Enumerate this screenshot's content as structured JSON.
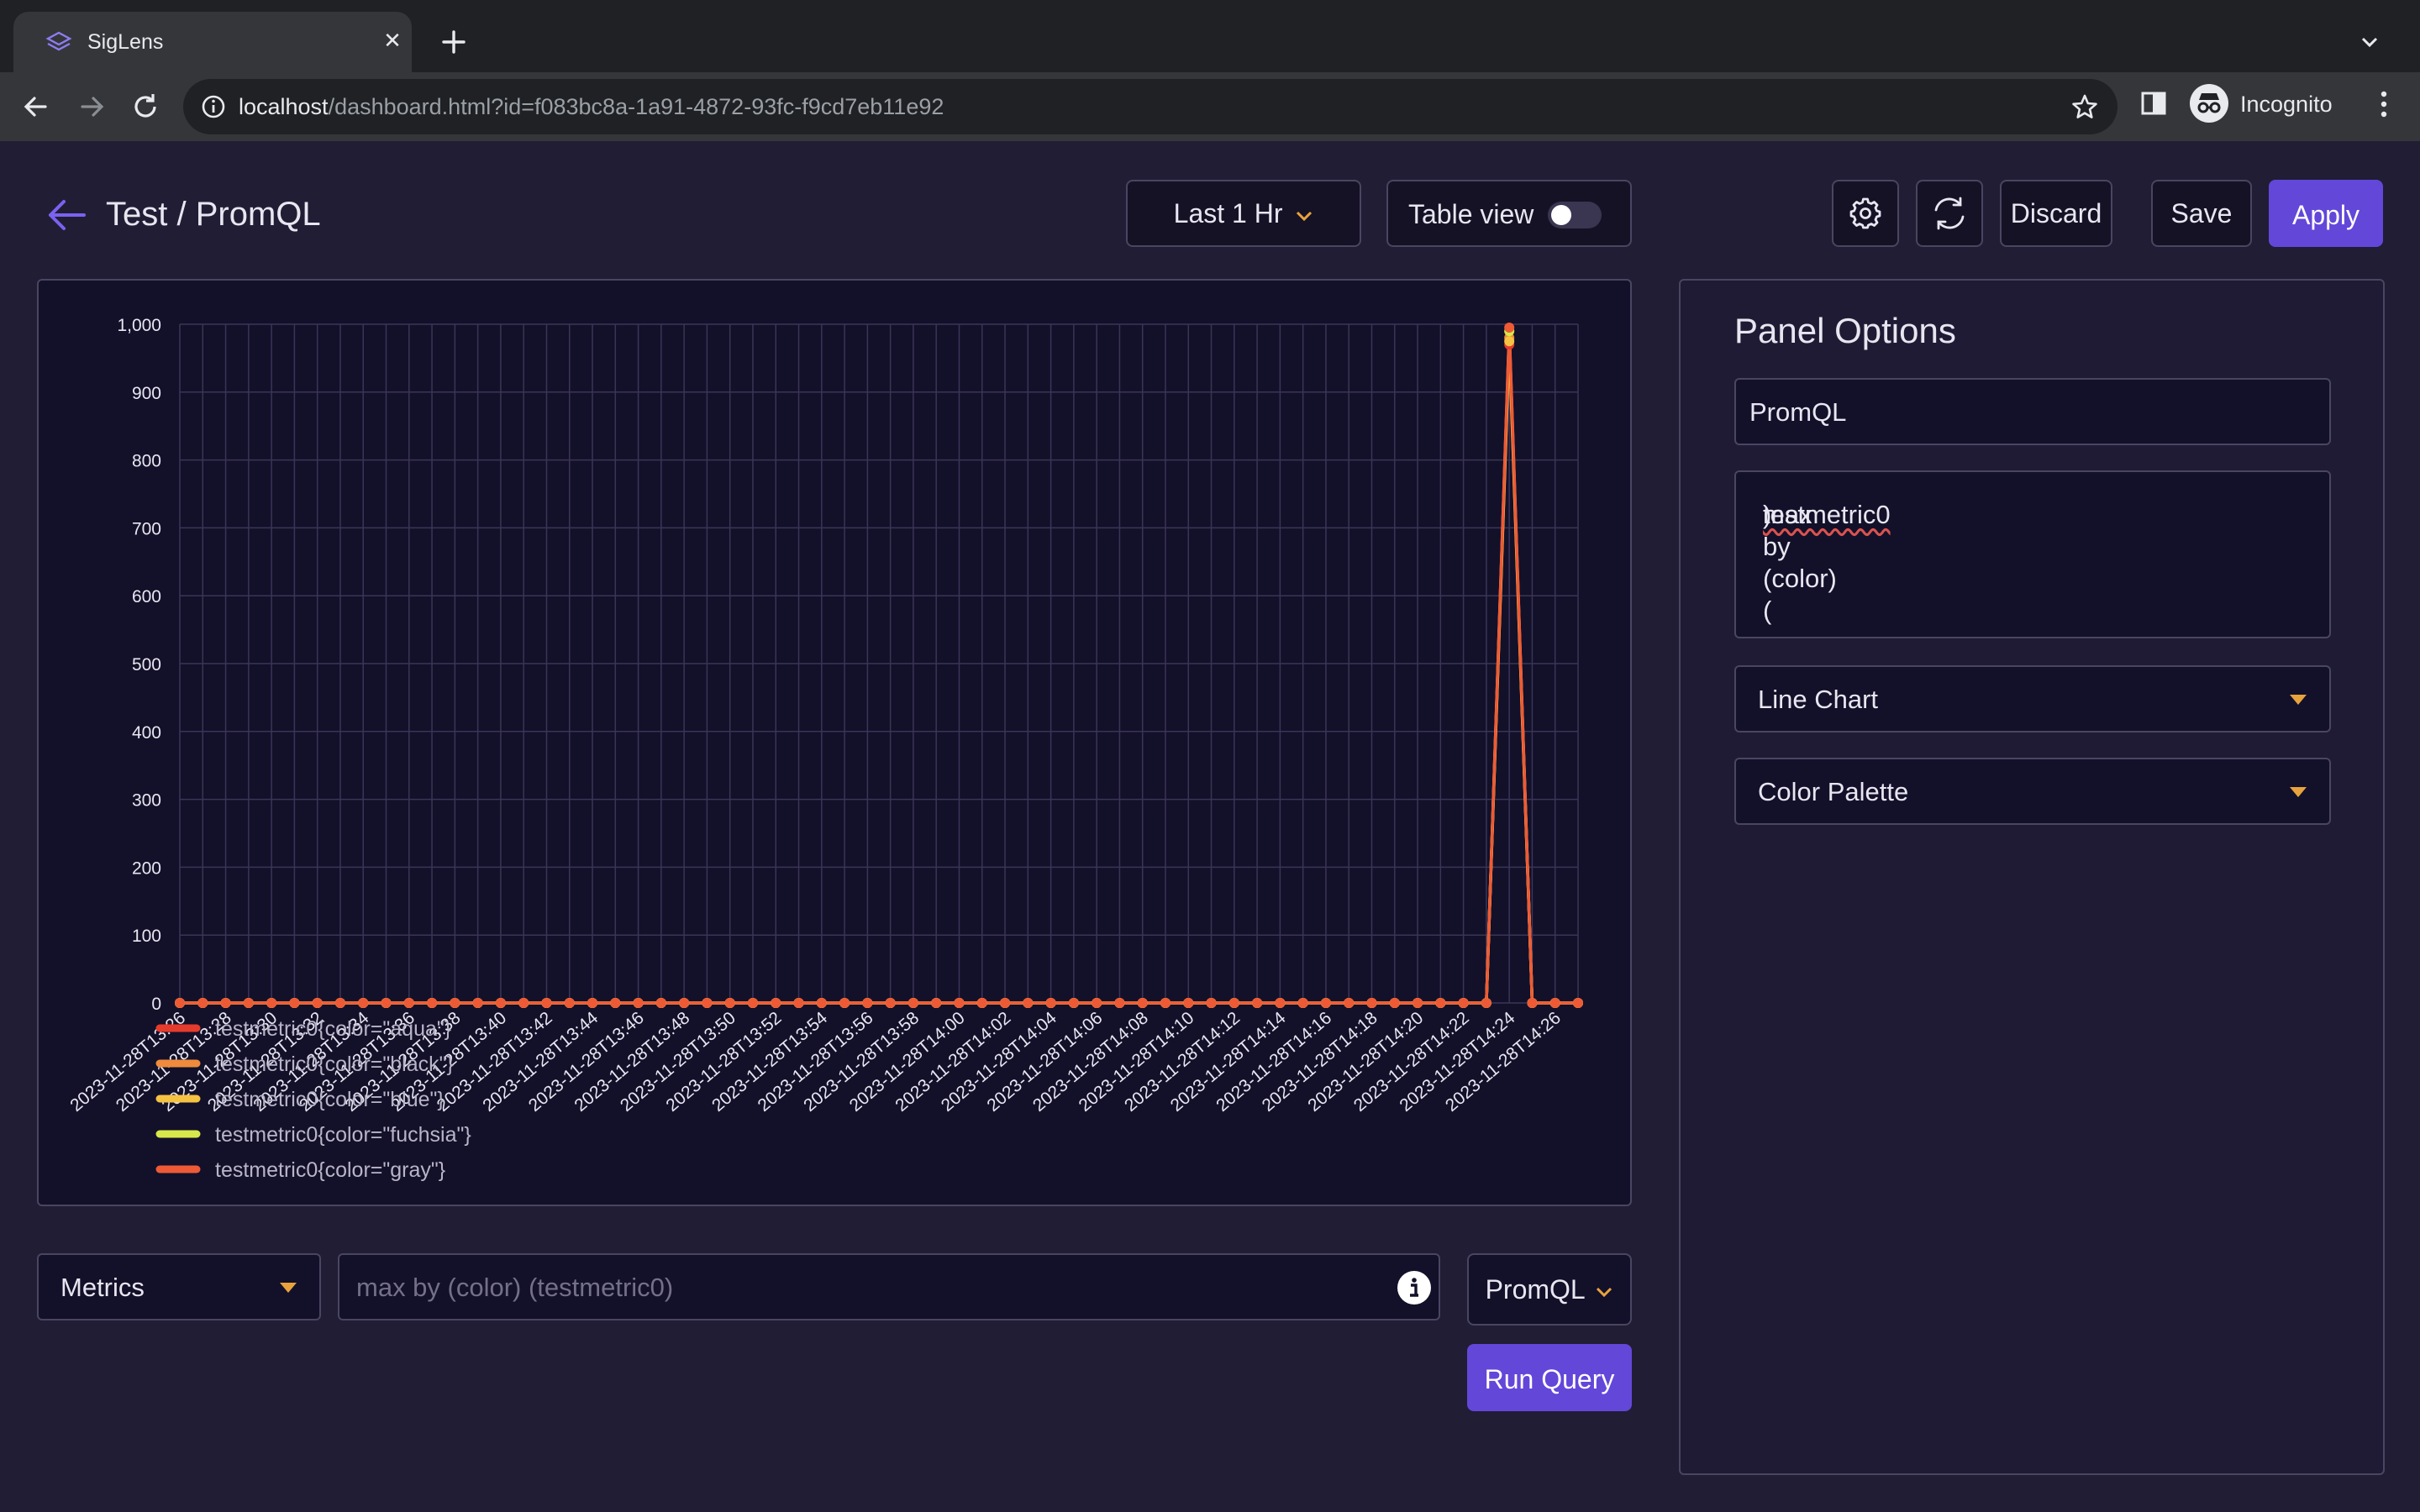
{
  "browser": {
    "tab_title": "SigLens",
    "url_host": "localhost",
    "url_path": "/dashboard.html?id=f083bc8a-1a91-4872-93fc-f9cd7eb11e92",
    "profile_label": "Incognito"
  },
  "header": {
    "breadcrumb": "Test / PromQL",
    "time_range": "Last 1 Hr",
    "table_view_label": "Table view",
    "table_view_on": false,
    "discard_label": "Discard",
    "save_label": "Save",
    "apply_label": "Apply"
  },
  "panel_options": {
    "title": "Panel Options",
    "panel_name": "PromQL",
    "query_text": "max by (color) (testmetric0)",
    "chart_type": "Line Chart",
    "color_palette": "Color Palette"
  },
  "query_bar": {
    "data_source": "Metrics",
    "placeholder": "max by (color) (testmetric0)",
    "language": "PromQL",
    "run_label": "Run Query"
  },
  "colors": {
    "accent": "#6347d9",
    "background": "#211d35",
    "chart_background": "#13102a",
    "caret": "#e8a33d"
  },
  "chart_data": {
    "type": "line",
    "ylim": [
      0,
      1000
    ],
    "yticks": [
      "1,000",
      "900",
      "800",
      "700",
      "600",
      "500",
      "400",
      "300",
      "200",
      "100",
      "0"
    ],
    "ytick_values": [
      1000,
      900,
      800,
      700,
      600,
      500,
      400,
      300,
      200,
      100,
      0
    ],
    "x_labels": [
      "2023-11-28T13:26",
      "2023-11-28T13:28",
      "2023-11-28T13:30",
      "2023-11-28T13:32",
      "2023-11-28T13:34",
      "2023-11-28T13:36",
      "2023-11-28T13:38",
      "2023-11-28T13:40",
      "2023-11-28T13:42",
      "2023-11-28T13:44",
      "2023-11-28T13:46",
      "2023-11-28T13:48",
      "2023-11-28T13:50",
      "2023-11-28T13:52",
      "2023-11-28T13:54",
      "2023-11-28T13:56",
      "2023-11-28T13:58",
      "2023-11-28T14:00",
      "2023-11-28T14:02",
      "2023-11-28T14:04",
      "2023-11-28T14:06",
      "2023-11-28T14:08",
      "2023-11-28T14:10",
      "2023-11-28T14:12",
      "2023-11-28T14:14",
      "2023-11-28T14:16",
      "2023-11-28T14:18",
      "2023-11-28T14:20",
      "2023-11-28T14:22",
      "2023-11-28T14:24",
      "2023-11-28T14:26"
    ],
    "grid": true,
    "legend_position": "bottom-left",
    "series": [
      {
        "name": "testmetric0{color=\"aqua\"}",
        "color": "#e53b2c",
        "values": [
          0,
          0,
          0,
          0,
          0,
          0,
          0,
          0,
          0,
          0,
          0,
          0,
          0,
          0,
          0,
          0,
          0,
          0,
          0,
          0,
          0,
          0,
          0,
          0,
          0,
          0,
          0,
          0,
          0,
          0,
          0,
          0,
          0,
          0,
          0,
          0,
          0,
          0,
          0,
          0,
          0,
          0,
          0,
          0,
          0,
          0,
          0,
          0,
          0,
          0,
          0,
          0,
          0,
          0,
          0,
          0,
          0,
          0,
          970,
          0,
          0,
          0
        ]
      },
      {
        "name": "testmetric0{color=\"black\"}",
        "color": "#f08a3c",
        "values": [
          0,
          0,
          0,
          0,
          0,
          0,
          0,
          0,
          0,
          0,
          0,
          0,
          0,
          0,
          0,
          0,
          0,
          0,
          0,
          0,
          0,
          0,
          0,
          0,
          0,
          0,
          0,
          0,
          0,
          0,
          0,
          0,
          0,
          0,
          0,
          0,
          0,
          0,
          0,
          0,
          0,
          0,
          0,
          0,
          0,
          0,
          0,
          0,
          0,
          0,
          0,
          0,
          0,
          0,
          0,
          0,
          0,
          0,
          980,
          0,
          0,
          0
        ]
      },
      {
        "name": "testmetric0{color=\"blue\"}",
        "color": "#f5c242",
        "values": [
          0,
          0,
          0,
          0,
          0,
          0,
          0,
          0,
          0,
          0,
          0,
          0,
          0,
          0,
          0,
          0,
          0,
          0,
          0,
          0,
          0,
          0,
          0,
          0,
          0,
          0,
          0,
          0,
          0,
          0,
          0,
          0,
          0,
          0,
          0,
          0,
          0,
          0,
          0,
          0,
          0,
          0,
          0,
          0,
          0,
          0,
          0,
          0,
          0,
          0,
          0,
          0,
          0,
          0,
          0,
          0,
          0,
          0,
          975,
          0,
          0,
          0
        ]
      },
      {
        "name": "testmetric0{color=\"fuchsia\"}",
        "color": "#d6e84a",
        "values": [
          0,
          0,
          0,
          0,
          0,
          0,
          0,
          0,
          0,
          0,
          0,
          0,
          0,
          0,
          0,
          0,
          0,
          0,
          0,
          0,
          0,
          0,
          0,
          0,
          0,
          0,
          0,
          0,
          0,
          0,
          0,
          0,
          0,
          0,
          0,
          0,
          0,
          0,
          0,
          0,
          0,
          0,
          0,
          0,
          0,
          0,
          0,
          0,
          0,
          0,
          0,
          0,
          0,
          0,
          0,
          0,
          0,
          0,
          990,
          0,
          0,
          0
        ]
      },
      {
        "name": "testmetric0{color=\"gray\"}",
        "color": "#ee5a36",
        "values": [
          0,
          0,
          0,
          0,
          0,
          0,
          0,
          0,
          0,
          0,
          0,
          0,
          0,
          0,
          0,
          0,
          0,
          0,
          0,
          0,
          0,
          0,
          0,
          0,
          0,
          0,
          0,
          0,
          0,
          0,
          0,
          0,
          0,
          0,
          0,
          0,
          0,
          0,
          0,
          0,
          0,
          0,
          0,
          0,
          0,
          0,
          0,
          0,
          0,
          0,
          0,
          0,
          0,
          0,
          0,
          0,
          0,
          0,
          995,
          0,
          0,
          0
        ]
      }
    ]
  }
}
